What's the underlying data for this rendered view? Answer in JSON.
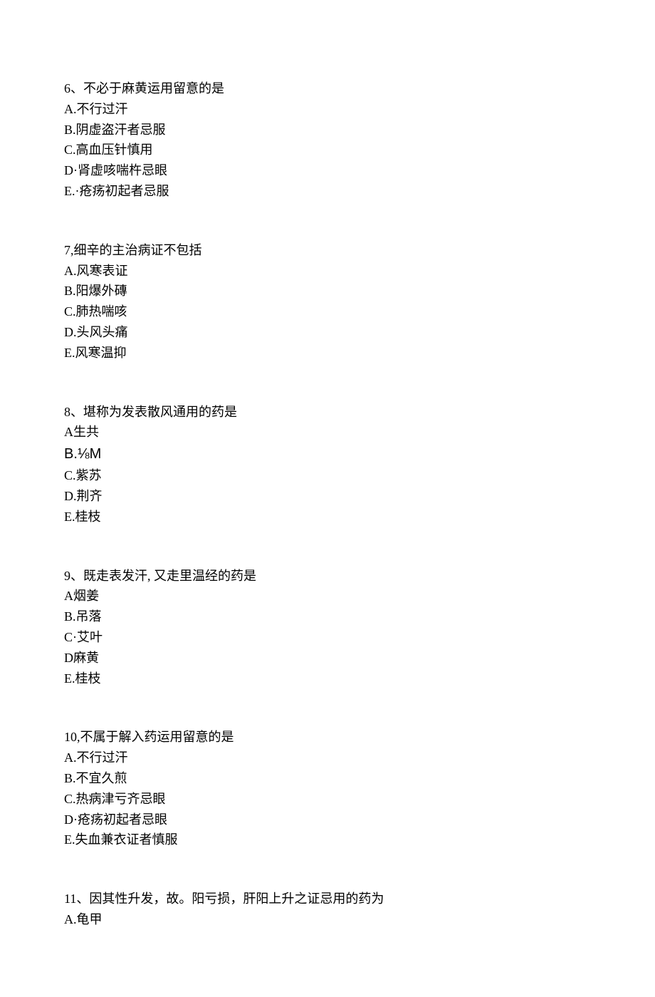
{
  "questions": [
    {
      "number": "6、",
      "stem": "不必于麻黄运用留意的是",
      "options": [
        "A.不行过汗",
        "B.阴虚盗汗者忌服",
        "C.高血压针慎用",
        "D·肾虚咳喘杵忌眼",
        "E.·疮疡初起者忌服"
      ]
    },
    {
      "number": "7,",
      "stem": "细辛的主治病证不包括",
      "options": [
        "A.风寒表证",
        "B.阳爆外磚",
        "C.肺热喘咳",
        "D.头风头痛",
        "E.风寒温抑"
      ]
    },
    {
      "number": "8、",
      "stem": "堪称为发表散风通用的药是",
      "options": [
        "A生共",
        "B.⅛M",
        "C.紫苏",
        "D.荆齐",
        "E.桂枝"
      ],
      "specialOptionIndex": 1
    },
    {
      "number": "9、",
      "stem": "既走表发汗, 又走里温经的药是",
      "options": [
        "A烟姜",
        "B.吊落",
        "C·艾叶",
        "D麻黄",
        "E.桂枝"
      ]
    },
    {
      "number": "10,",
      "stem": "不属于解入药运用留意的是",
      "options": [
        "A.不行过汗",
        "B.不宜久煎",
        "C.热病津亏齐忌眼",
        "D·疮疡初起者忌眼",
        "E.失血兼衣证者慎服"
      ]
    },
    {
      "number": "11、",
      "stem": "因其性升发，故。阳亏损，肝阳上升之证忌用的药为",
      "options": [
        "A.龟甲"
      ]
    }
  ]
}
